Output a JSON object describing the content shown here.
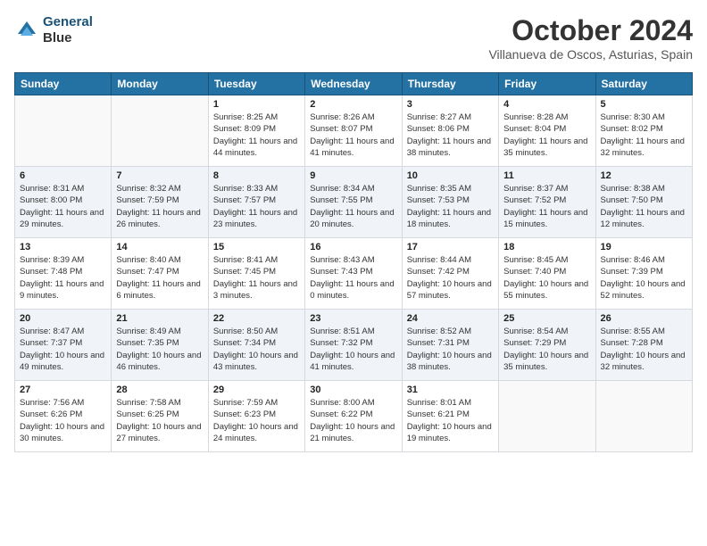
{
  "logo": {
    "line1": "General",
    "line2": "Blue"
  },
  "title": "October 2024",
  "subtitle": "Villanueva de Oscos, Asturias, Spain",
  "weekdays": [
    "Sunday",
    "Monday",
    "Tuesday",
    "Wednesday",
    "Thursday",
    "Friday",
    "Saturday"
  ],
  "weeks": [
    [
      {
        "day": "",
        "info": ""
      },
      {
        "day": "",
        "info": ""
      },
      {
        "day": "1",
        "info": "Sunrise: 8:25 AM\nSunset: 8:09 PM\nDaylight: 11 hours and 44 minutes."
      },
      {
        "day": "2",
        "info": "Sunrise: 8:26 AM\nSunset: 8:07 PM\nDaylight: 11 hours and 41 minutes."
      },
      {
        "day": "3",
        "info": "Sunrise: 8:27 AM\nSunset: 8:06 PM\nDaylight: 11 hours and 38 minutes."
      },
      {
        "day": "4",
        "info": "Sunrise: 8:28 AM\nSunset: 8:04 PM\nDaylight: 11 hours and 35 minutes."
      },
      {
        "day": "5",
        "info": "Sunrise: 8:30 AM\nSunset: 8:02 PM\nDaylight: 11 hours and 32 minutes."
      }
    ],
    [
      {
        "day": "6",
        "info": "Sunrise: 8:31 AM\nSunset: 8:00 PM\nDaylight: 11 hours and 29 minutes."
      },
      {
        "day": "7",
        "info": "Sunrise: 8:32 AM\nSunset: 7:59 PM\nDaylight: 11 hours and 26 minutes."
      },
      {
        "day": "8",
        "info": "Sunrise: 8:33 AM\nSunset: 7:57 PM\nDaylight: 11 hours and 23 minutes."
      },
      {
        "day": "9",
        "info": "Sunrise: 8:34 AM\nSunset: 7:55 PM\nDaylight: 11 hours and 20 minutes."
      },
      {
        "day": "10",
        "info": "Sunrise: 8:35 AM\nSunset: 7:53 PM\nDaylight: 11 hours and 18 minutes."
      },
      {
        "day": "11",
        "info": "Sunrise: 8:37 AM\nSunset: 7:52 PM\nDaylight: 11 hours and 15 minutes."
      },
      {
        "day": "12",
        "info": "Sunrise: 8:38 AM\nSunset: 7:50 PM\nDaylight: 11 hours and 12 minutes."
      }
    ],
    [
      {
        "day": "13",
        "info": "Sunrise: 8:39 AM\nSunset: 7:48 PM\nDaylight: 11 hours and 9 minutes."
      },
      {
        "day": "14",
        "info": "Sunrise: 8:40 AM\nSunset: 7:47 PM\nDaylight: 11 hours and 6 minutes."
      },
      {
        "day": "15",
        "info": "Sunrise: 8:41 AM\nSunset: 7:45 PM\nDaylight: 11 hours and 3 minutes."
      },
      {
        "day": "16",
        "info": "Sunrise: 8:43 AM\nSunset: 7:43 PM\nDaylight: 11 hours and 0 minutes."
      },
      {
        "day": "17",
        "info": "Sunrise: 8:44 AM\nSunset: 7:42 PM\nDaylight: 10 hours and 57 minutes."
      },
      {
        "day": "18",
        "info": "Sunrise: 8:45 AM\nSunset: 7:40 PM\nDaylight: 10 hours and 55 minutes."
      },
      {
        "day": "19",
        "info": "Sunrise: 8:46 AM\nSunset: 7:39 PM\nDaylight: 10 hours and 52 minutes."
      }
    ],
    [
      {
        "day": "20",
        "info": "Sunrise: 8:47 AM\nSunset: 7:37 PM\nDaylight: 10 hours and 49 minutes."
      },
      {
        "day": "21",
        "info": "Sunrise: 8:49 AM\nSunset: 7:35 PM\nDaylight: 10 hours and 46 minutes."
      },
      {
        "day": "22",
        "info": "Sunrise: 8:50 AM\nSunset: 7:34 PM\nDaylight: 10 hours and 43 minutes."
      },
      {
        "day": "23",
        "info": "Sunrise: 8:51 AM\nSunset: 7:32 PM\nDaylight: 10 hours and 41 minutes."
      },
      {
        "day": "24",
        "info": "Sunrise: 8:52 AM\nSunset: 7:31 PM\nDaylight: 10 hours and 38 minutes."
      },
      {
        "day": "25",
        "info": "Sunrise: 8:54 AM\nSunset: 7:29 PM\nDaylight: 10 hours and 35 minutes."
      },
      {
        "day": "26",
        "info": "Sunrise: 8:55 AM\nSunset: 7:28 PM\nDaylight: 10 hours and 32 minutes."
      }
    ],
    [
      {
        "day": "27",
        "info": "Sunrise: 7:56 AM\nSunset: 6:26 PM\nDaylight: 10 hours and 30 minutes."
      },
      {
        "day": "28",
        "info": "Sunrise: 7:58 AM\nSunset: 6:25 PM\nDaylight: 10 hours and 27 minutes."
      },
      {
        "day": "29",
        "info": "Sunrise: 7:59 AM\nSunset: 6:23 PM\nDaylight: 10 hours and 24 minutes."
      },
      {
        "day": "30",
        "info": "Sunrise: 8:00 AM\nSunset: 6:22 PM\nDaylight: 10 hours and 21 minutes."
      },
      {
        "day": "31",
        "info": "Sunrise: 8:01 AM\nSunset: 6:21 PM\nDaylight: 10 hours and 19 minutes."
      },
      {
        "day": "",
        "info": ""
      },
      {
        "day": "",
        "info": ""
      }
    ]
  ]
}
